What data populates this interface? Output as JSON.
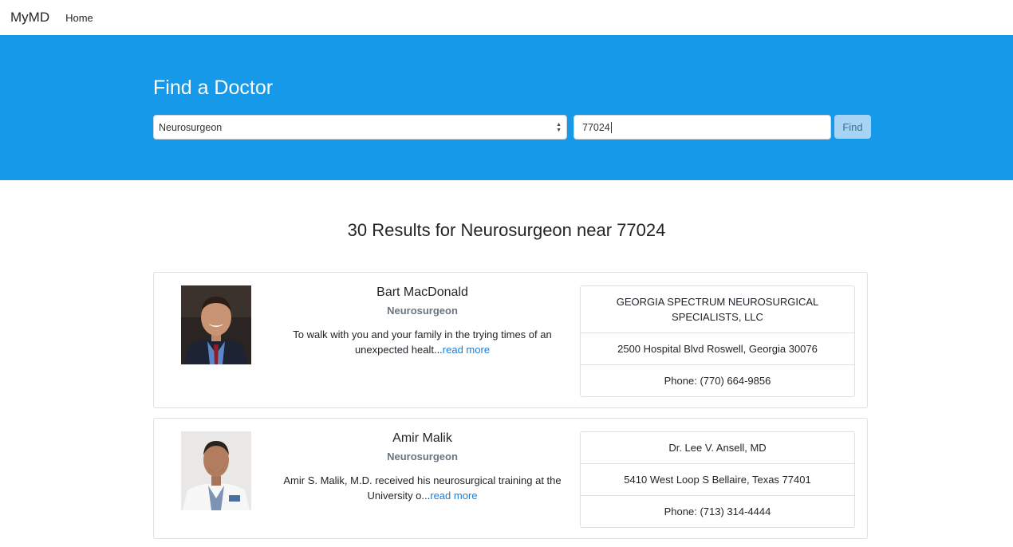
{
  "nav": {
    "brand": "MyMD",
    "home": "Home"
  },
  "search": {
    "title": "Find a Doctor",
    "specialty": "Neurosurgeon",
    "zip": "77024",
    "find_label": "Find"
  },
  "colors": {
    "hero": "#1699e9",
    "link": "#1a7fd6",
    "find_button": "#a7d4f4"
  },
  "results": {
    "heading": "30 Results for Neurosurgeon near 77024",
    "doctors": [
      {
        "name": "Bart MacDonald",
        "specialty": "Neurosurgeon",
        "bio": "To walk with you and your family in the trying times of an unexpected healt...",
        "read_more": "read more",
        "practice": "GEORGIA SPECTRUM NEUROSURGICAL SPECIALISTS, LLC",
        "address": "2500 Hospital Blvd Roswell, Georgia 30076",
        "phone": "Phone: (770) 664-9856"
      },
      {
        "name": "Amir Malik",
        "specialty": "Neurosurgeon",
        "bio": "Amir S. Malik, M.D. received his neurosurgical training at the University o...",
        "read_more": "read more",
        "practice": "Dr. Lee V. Ansell, MD",
        "address": "5410 West Loop S Bellaire, Texas 77401",
        "phone": "Phone: (713) 314-4444"
      }
    ]
  }
}
